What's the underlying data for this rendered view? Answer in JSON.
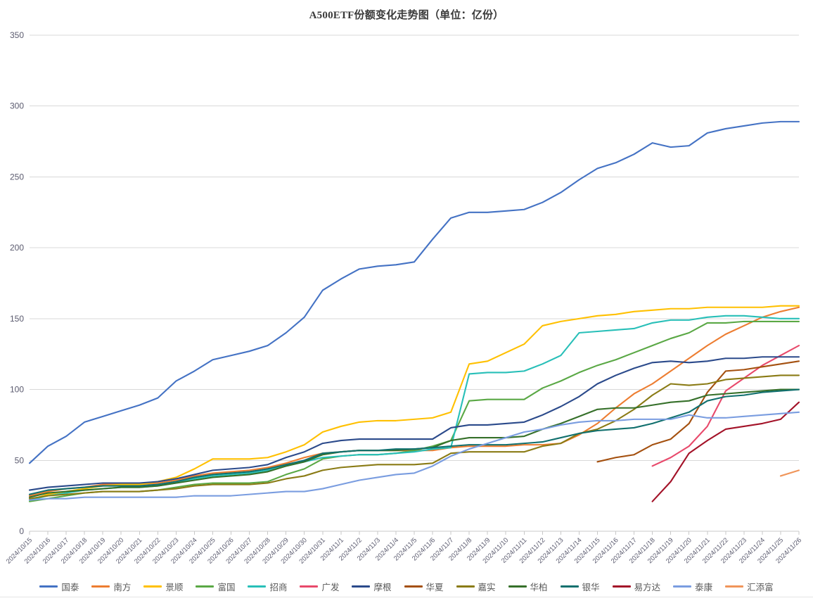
{
  "chart_title": "A500ETF份额变化走势图（单位：亿份）",
  "axis": {
    "y_ticks": [
      "0",
      "50",
      "100",
      "150",
      "200",
      "250",
      "300",
      "350"
    ],
    "y_min": 0,
    "y_max": 350
  },
  "legend": {
    "position": "bottom",
    "items": [
      {
        "label": "国泰",
        "color": "#4472c4"
      },
      {
        "label": "南方",
        "color": "#ed7d31"
      },
      {
        "label": "景顺",
        "color": "#ffc000"
      },
      {
        "label": "富国",
        "color": "#5aa845"
      },
      {
        "label": "招商",
        "color": "#28bfb8"
      },
      {
        "label": "广发",
        "color": "#e8496b"
      },
      {
        "label": "摩根",
        "color": "#2b4a8b"
      },
      {
        "label": "华夏",
        "color": "#a4500f"
      },
      {
        "label": "嘉实",
        "color": "#8a7b15"
      },
      {
        "label": "华柏",
        "color": "#36702a"
      },
      {
        "label": "银华",
        "color": "#11706e"
      },
      {
        "label": "易方达",
        "color": "#a31228"
      },
      {
        "label": "泰康",
        "color": "#7a9de0"
      },
      {
        "label": "汇添富",
        "color": "#f0955a"
      }
    ]
  },
  "chart_data": {
    "type": "line",
    "title": "A500ETF份额变化走势图（单位：亿份）",
    "xlabel": "",
    "ylabel": "",
    "ylim": [
      0,
      350
    ],
    "grid": true,
    "legend_position": "bottom",
    "categories": [
      "2024/10/15",
      "2024/10/16",
      "2024/10/17",
      "2024/10/18",
      "2024/10/19",
      "2024/10/20",
      "2024/10/21",
      "2024/10/22",
      "2024/10/23",
      "2024/10/24",
      "2024/10/25",
      "2024/10/26",
      "2024/10/27",
      "2024/10/28",
      "2024/10/29",
      "2024/10/30",
      "2024/10/31",
      "2024/11/1",
      "2024/11/2",
      "2024/11/3",
      "2024/11/4",
      "2024/11/5",
      "2024/11/6",
      "2024/11/7",
      "2024/11/8",
      "2024/11/9",
      "2024/11/10",
      "2024/11/11",
      "2024/11/12",
      "2024/11/13",
      "2024/11/14",
      "2024/11/15",
      "2024/11/16",
      "2024/11/17",
      "2024/11/18",
      "2024/11/19",
      "2024/11/20",
      "2024/11/21",
      "2024/11/22",
      "2024/11/23",
      "2024/11/24",
      "2024/11/25",
      "2024/11/26"
    ],
    "series": [
      {
        "name": "国泰",
        "color": "#4472c4",
        "values": [
          48,
          60,
          67,
          77,
          81,
          85,
          89,
          94,
          106,
          113,
          121,
          124,
          127,
          131,
          140,
          151,
          170,
          178,
          185,
          187,
          188,
          190,
          206,
          221,
          225,
          225,
          226,
          227,
          232,
          239,
          248,
          256,
          260,
          266,
          274,
          271,
          272,
          281,
          284,
          286,
          288,
          289,
          289
        ]
      },
      {
        "name": "南方",
        "color": "#ed7d31",
        "values": [
          25,
          28,
          30,
          31,
          33,
          33,
          33,
          34,
          36,
          39,
          41,
          42,
          43,
          45,
          48,
          52,
          55,
          56,
          57,
          57,
          57,
          57,
          57,
          59,
          60,
          60,
          60,
          61,
          61,
          62,
          68,
          76,
          87,
          97,
          104,
          113,
          122,
          131,
          139,
          145,
          151,
          155,
          158
        ]
      },
      {
        "name": "景顺",
        "color": "#ffc000",
        "values": [
          22,
          26,
          28,
          30,
          32,
          33,
          33,
          35,
          38,
          44,
          51,
          51,
          51,
          52,
          56,
          61,
          70,
          74,
          77,
          78,
          78,
          79,
          80,
          84,
          118,
          120,
          126,
          132,
          145,
          148,
          150,
          152,
          153,
          155,
          156,
          157,
          157,
          158,
          158,
          158,
          158,
          159,
          159
        ]
      },
      {
        "name": "富国",
        "color": "#5aa845",
        "values": [
          21,
          23,
          25,
          27,
          28,
          28,
          28,
          29,
          31,
          33,
          34,
          34,
          34,
          35,
          40,
          44,
          51,
          53,
          54,
          54,
          55,
          57,
          60,
          64,
          92,
          93,
          93,
          93,
          101,
          106,
          112,
          117,
          121,
          126,
          131,
          136,
          140,
          147,
          147,
          148,
          148,
          148,
          148
        ]
      },
      {
        "name": "招商",
        "color": "#28bfb8",
        "values": [
          22,
          25,
          27,
          29,
          30,
          31,
          31,
          32,
          34,
          37,
          39,
          40,
          41,
          43,
          46,
          49,
          52,
          53,
          54,
          54,
          55,
          56,
          58,
          59,
          111,
          112,
          112,
          113,
          118,
          124,
          140,
          141,
          142,
          143,
          147,
          149,
          149,
          151,
          152,
          152,
          151,
          150,
          150
        ]
      },
      {
        "name": "广发",
        "color": "#e8496b",
        "values": [
          null,
          null,
          null,
          null,
          null,
          null,
          null,
          null,
          null,
          null,
          null,
          null,
          null,
          null,
          null,
          null,
          null,
          null,
          null,
          null,
          null,
          null,
          null,
          null,
          null,
          null,
          null,
          null,
          null,
          null,
          null,
          null,
          null,
          null,
          46,
          52,
          60,
          74,
          99,
          108,
          117,
          124,
          131
        ]
      },
      {
        "name": "摩根",
        "color": "#2b4a8b",
        "values": [
          29,
          31,
          32,
          33,
          34,
          34,
          34,
          35,
          37,
          40,
          43,
          44,
          45,
          47,
          52,
          56,
          62,
          64,
          65,
          65,
          65,
          65,
          65,
          73,
          75,
          75,
          76,
          77,
          82,
          88,
          95,
          104,
          110,
          115,
          119,
          120,
          119,
          120,
          122,
          122,
          123,
          123,
          123
        ]
      },
      {
        "name": "华夏",
        "color": "#a4500f",
        "values": [
          null,
          null,
          null,
          null,
          null,
          null,
          null,
          null,
          null,
          null,
          null,
          null,
          null,
          null,
          null,
          null,
          null,
          null,
          null,
          null,
          null,
          null,
          null,
          null,
          null,
          null,
          null,
          null,
          null,
          null,
          null,
          49,
          52,
          54,
          61,
          65,
          76,
          98,
          113,
          114,
          116,
          118,
          120
        ]
      },
      {
        "name": "嘉实",
        "color": "#8a7b15",
        "values": [
          23,
          25,
          26,
          27,
          28,
          28,
          28,
          29,
          30,
          32,
          33,
          33,
          33,
          34,
          37,
          39,
          43,
          45,
          46,
          47,
          47,
          47,
          48,
          55,
          56,
          56,
          56,
          56,
          60,
          62,
          69,
          72,
          78,
          86,
          96,
          104,
          103,
          104,
          107,
          108,
          109,
          110,
          110
        ]
      },
      {
        "name": "华柏",
        "color": "#36702a",
        "values": [
          24,
          27,
          28,
          29,
          30,
          31,
          31,
          32,
          34,
          36,
          38,
          39,
          40,
          42,
          46,
          49,
          54,
          56,
          57,
          57,
          57,
          58,
          59,
          64,
          66,
          66,
          66,
          67,
          72,
          76,
          81,
          86,
          87,
          87,
          89,
          91,
          92,
          96,
          97,
          98,
          99,
          100,
          100
        ]
      },
      {
        "name": "银华",
        "color": "#11706e",
        "values": [
          26,
          29,
          30,
          31,
          32,
          32,
          32,
          33,
          35,
          38,
          40,
          41,
          42,
          44,
          47,
          50,
          55,
          56,
          57,
          57,
          58,
          58,
          59,
          60,
          61,
          61,
          61,
          62,
          63,
          66,
          69,
          71,
          72,
          73,
          76,
          80,
          84,
          92,
          95,
          96,
          98,
          99,
          100
        ]
      },
      {
        "name": "易方达",
        "color": "#a31228",
        "values": [
          null,
          null,
          null,
          null,
          null,
          null,
          null,
          null,
          null,
          null,
          null,
          null,
          null,
          null,
          null,
          null,
          null,
          null,
          null,
          null,
          null,
          null,
          null,
          null,
          null,
          null,
          null,
          null,
          null,
          null,
          null,
          null,
          null,
          null,
          21,
          35,
          55,
          64,
          72,
          74,
          76,
          79,
          91
        ]
      },
      {
        "name": "泰康",
        "color": "#7a9de0",
        "values": [
          22,
          23,
          23,
          24,
          24,
          24,
          24,
          24,
          24,
          25,
          25,
          25,
          26,
          27,
          28,
          28,
          30,
          33,
          36,
          38,
          40,
          41,
          46,
          53,
          58,
          62,
          66,
          70,
          72,
          75,
          77,
          78,
          78,
          79,
          79,
          79,
          82,
          80,
          80,
          81,
          82,
          83,
          84
        ]
      },
      {
        "name": "汇添富",
        "color": "#f0955a",
        "values": [
          null,
          null,
          null,
          null,
          null,
          null,
          null,
          null,
          null,
          null,
          null,
          null,
          null,
          null,
          null,
          null,
          null,
          null,
          null,
          null,
          null,
          null,
          null,
          null,
          null,
          null,
          null,
          null,
          null,
          null,
          null,
          null,
          null,
          null,
          null,
          null,
          null,
          null,
          null,
          null,
          null,
          39,
          43
        ]
      }
    ]
  }
}
